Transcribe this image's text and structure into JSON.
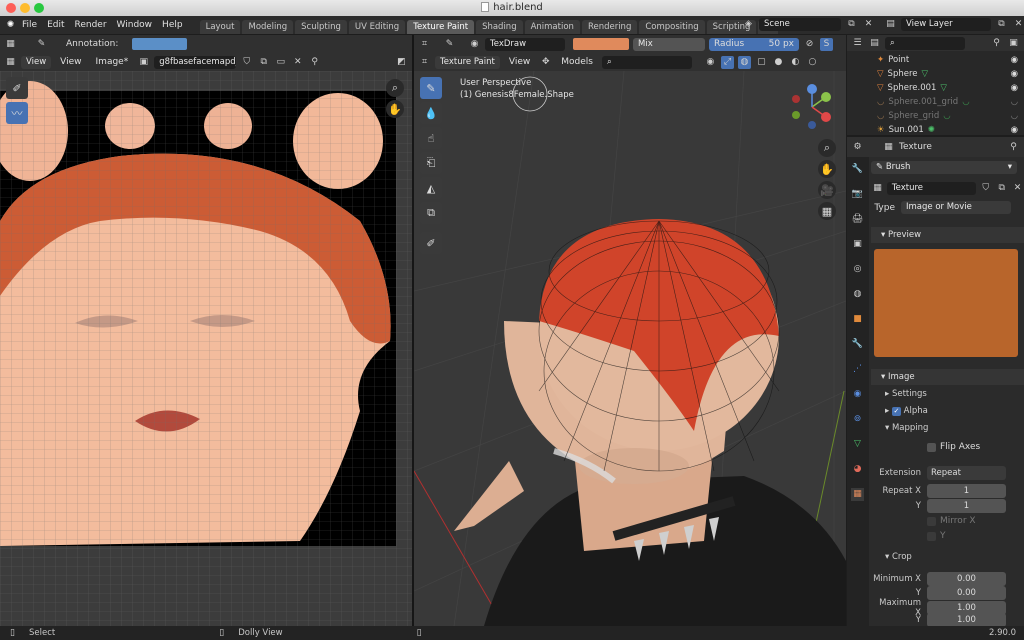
{
  "window": {
    "title": "hair.blend"
  },
  "menu": {
    "items": [
      "File",
      "Edit",
      "Render",
      "Window",
      "Help"
    ]
  },
  "workspaces": [
    "Layout",
    "Modeling",
    "Sculpting",
    "UV Editing",
    "Texture Paint",
    "Shading",
    "Animation",
    "Rendering",
    "Compositing",
    "Scripting"
  ],
  "active_workspace": "Texture Paint",
  "scene": {
    "label": "Scene",
    "view_layer": "View Layer"
  },
  "image_editor": {
    "annotation_label": "Annotation:",
    "annotation_color": "#5b8fc7",
    "menu": [
      "View",
      "View",
      "Image*"
    ],
    "image_name": "g8fbasefacemapd_..."
  },
  "viewport": {
    "mode": "Texture Paint",
    "brush_name": "TexDraw",
    "brush_color": "#e08a5c",
    "blend": "Mix",
    "radius_label": "Radius",
    "radius_value": "50 px",
    "view_menu": "View",
    "models_menu": "Models",
    "overlay_line1": "User Perspective",
    "overlay_line2": "(1) Genesis8Female.Shape"
  },
  "outliner": {
    "items": [
      {
        "name": "Point",
        "faded": false
      },
      {
        "name": "Sphere",
        "faded": false
      },
      {
        "name": "Sphere.001",
        "faded": false
      },
      {
        "name": "Sphere.001_grid",
        "faded": true
      },
      {
        "name": "Sphere_grid",
        "faded": true
      },
      {
        "name": "Sun.001",
        "faded": false
      }
    ]
  },
  "properties": {
    "tab_title": "Texture",
    "brush_selector": "Brush",
    "texture_name": "Texture",
    "type_label": "Type",
    "type_value": "Image or Movie",
    "preview_label": "Preview",
    "preview_color": "#b8652b",
    "image_section": "Image",
    "settings_label": "Settings",
    "alpha_label": "Alpha",
    "mapping_label": "Mapping",
    "flip_axes": "Flip Axes",
    "extension_label": "Extension",
    "extension_value": "Repeat",
    "repeat_x_label": "Repeat X",
    "repeat_x": "1",
    "y_label": "Y",
    "repeat_y": "1",
    "mirror_x": "Mirror X",
    "mirror_y": "Y",
    "crop_label": "Crop",
    "min_x_label": "Minimum X",
    "min_x": "0.00",
    "min_y_label": "Y",
    "min_y": "0.00",
    "max_x_label": "Maximum X",
    "max_x": "1.00",
    "max_y_label": "Y",
    "max_y": "1.00"
  },
  "status": {
    "select": "Select",
    "dolly": "Dolly View",
    "version": "2.90.0"
  }
}
